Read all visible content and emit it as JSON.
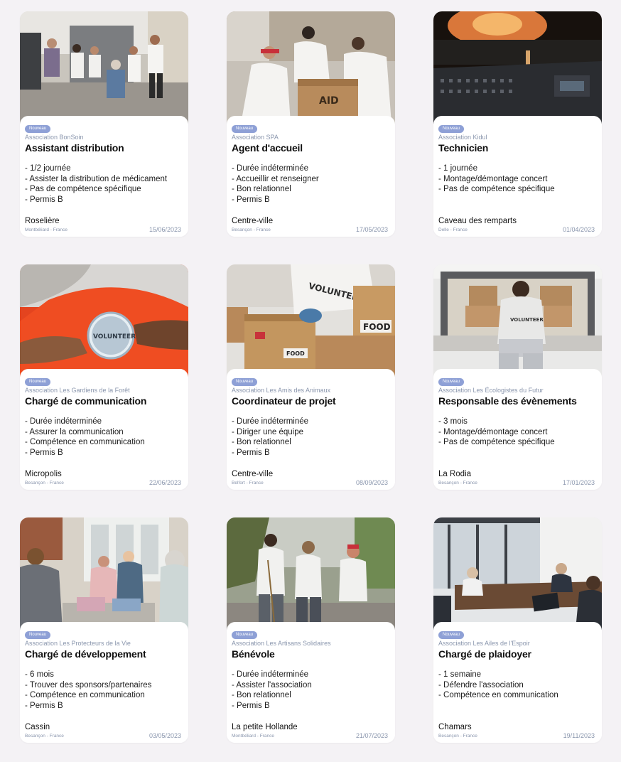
{
  "offers": [
    {
      "badge": "Nouveau",
      "association": "Association BonSoin",
      "title": "Assistant distribution",
      "details": [
        "- 1/2 journée",
        "- Assister la distribution de médicament",
        "- Pas de compétence spécifique",
        "- Permis B"
      ],
      "place": "Roselière",
      "location": "Montbéliard - France",
      "date": "15/06/2023",
      "image": "group-of-volunteers-photo"
    },
    {
      "badge": "Nouveau",
      "association": "Association SPA",
      "title": "Agent d'accueil",
      "details": [
        "- Durée indéterminée",
        "- Accueillir et renseigner",
        "- Bon relationnel",
        "- Permis B"
      ],
      "place": "Centre-ville",
      "location": "Besançon - France",
      "date": "17/05/2023",
      "image": "volunteers-packing-aid-boxes-photo"
    },
    {
      "badge": "Nouveau",
      "association": "Association Kidul",
      "title": "Technicien",
      "details": [
        "- 1 journée",
        "- Montage/démontage concert",
        "- Pas de compétence spécifique"
      ],
      "place": "Caveau des remparts",
      "location": "Delle - France",
      "date": "01/04/2023",
      "image": "concert-mixing-desk-photo"
    },
    {
      "badge": "Nouveau",
      "association": "Association Les Gardiens de la Forêt",
      "title": "Chargé de communication",
      "details": [
        "- Durée indéterminée",
        "- Assurer la communication",
        "- Compétence en communication",
        "- Permis B"
      ],
      "place": "Micropolis",
      "location": "Besançon - France",
      "date": "22/06/2023",
      "image": "volunteer-badge-photo"
    },
    {
      "badge": "Nouveau",
      "association": "Association Les Amis des Animaux",
      "title": "Coordinateur de projet",
      "details": [
        "- Durée indéterminée",
        "- Diriger une équipe",
        "- Bon relationnel",
        "- Permis B"
      ],
      "place": "Centre-ville",
      "location": "Belfort - France",
      "date": "08/09/2023",
      "image": "food-donation-boxes-photo"
    },
    {
      "badge": "Nouveau",
      "association": "Association Les Écologistes du Futur",
      "title": "Responsable des évènements",
      "details": [
        "- 3 mois",
        "- Montage/démontage concert",
        "- Pas de compétence spécifique"
      ],
      "place": "La Rodia",
      "location": "Besançon - France",
      "date": "17/01/2023",
      "image": "volunteer-sitting-on-van-photo"
    },
    {
      "badge": "Nouveau",
      "association": "Association Les Protecteurs de la Vie",
      "title": "Chargé de développement",
      "details": [
        "- 6 mois",
        "- Trouver des sponsors/partenaires",
        "- Compétence en communication",
        "- Permis B"
      ],
      "place": "Cassin",
      "location": "Besançon - France",
      "date": "03/05/2023",
      "image": "clothing-sorting-photo"
    },
    {
      "badge": "Nouveau",
      "association": "Association Les Artisans Solidaires",
      "title": "Bénévole",
      "details": [
        "- Durée indéterminée",
        "- Assister l'association",
        "- Bon relationnel",
        "- Permis B"
      ],
      "place": "La petite Hollande",
      "location": "Montbéliard - France",
      "date": "21/07/2023",
      "image": "street-cleanup-volunteers-photo"
    },
    {
      "badge": "Nouveau",
      "association": "Association Les Ailes de l'Espoir",
      "title": "Chargé de plaidoyer",
      "details": [
        "- 1 semaine",
        "- Défendre l'association",
        "- Compétence en communication"
      ],
      "place": "Chamars",
      "location": "Besançon - France",
      "date": "19/11/2023",
      "image": "meeting-room-photo"
    }
  ],
  "colors": {
    "background": "#f4f2f5",
    "badge": "#8ea0d6",
    "muted_text": "#8a96ad",
    "card": "#ffffff"
  }
}
